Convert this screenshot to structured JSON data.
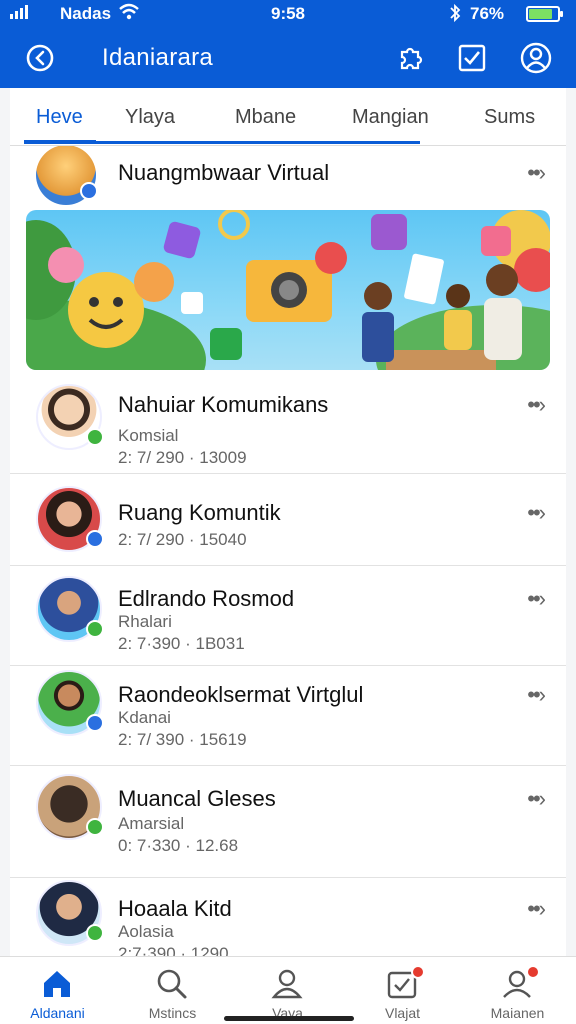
{
  "status_bar": {
    "carrier": "Nadas",
    "time": "9:58",
    "battery": "76%",
    "battery_level": 0.76
  },
  "app_bar": {
    "title": "Idaniarara",
    "icons": [
      "back-icon",
      "puzzle-icon",
      "checkbox-icon",
      "profile-icon"
    ]
  },
  "tabs": [
    {
      "label": "Heve",
      "active": true
    },
    {
      "label": "Ylaya",
      "active": false
    },
    {
      "label": "Mbane",
      "active": false
    },
    {
      "label": "Mangian",
      "active": false
    },
    {
      "label": "Sums",
      "active": false
    }
  ],
  "featured": {
    "name": "Nuangmbwaar Virtual",
    "chevron": "→"
  },
  "items": [
    {
      "name": "Nahuiar Komumikans",
      "sub": "Komsial",
      "meta": "2: 7/ 290 · 13009"
    },
    {
      "name": "Ruang Komuntik",
      "sub": "",
      "meta": "2: 7/ 290 · 15040"
    },
    {
      "name": "Edlrando Rosmod",
      "sub": "Rhalari",
      "meta": "2: 7·390 · 1B031"
    },
    {
      "name": "Raondeoklsermat Virtglul",
      "sub": "Kdanai",
      "meta": "2: 7/ 390 · 15619"
    },
    {
      "name": "Muancal Gleses",
      "sub": "Amarsial",
      "meta": "0: 7·330 · 12.68"
    },
    {
      "name": "Hoaala Kitd",
      "sub": "Aolasia",
      "meta": "2:7·390 · 1290"
    }
  ],
  "bottom_nav": [
    {
      "label": "Aldanani",
      "icon": "home-icon",
      "active": true,
      "badge": false
    },
    {
      "label": "Mstincs",
      "icon": "search-icon",
      "active": false,
      "badge": false
    },
    {
      "label": "Vaya",
      "icon": "person-icon",
      "active": false,
      "badge": false
    },
    {
      "label": "Vlajat",
      "icon": "tasks-icon",
      "active": false,
      "badge": true
    },
    {
      "label": "Maianen",
      "icon": "profile-icon",
      "active": false,
      "badge": true
    }
  ],
  "colors": {
    "primary": "#0a5cd6",
    "verified_green": "#3fb43f",
    "verified_blue": "#2a6fe0",
    "notification": "#e53b2f"
  }
}
